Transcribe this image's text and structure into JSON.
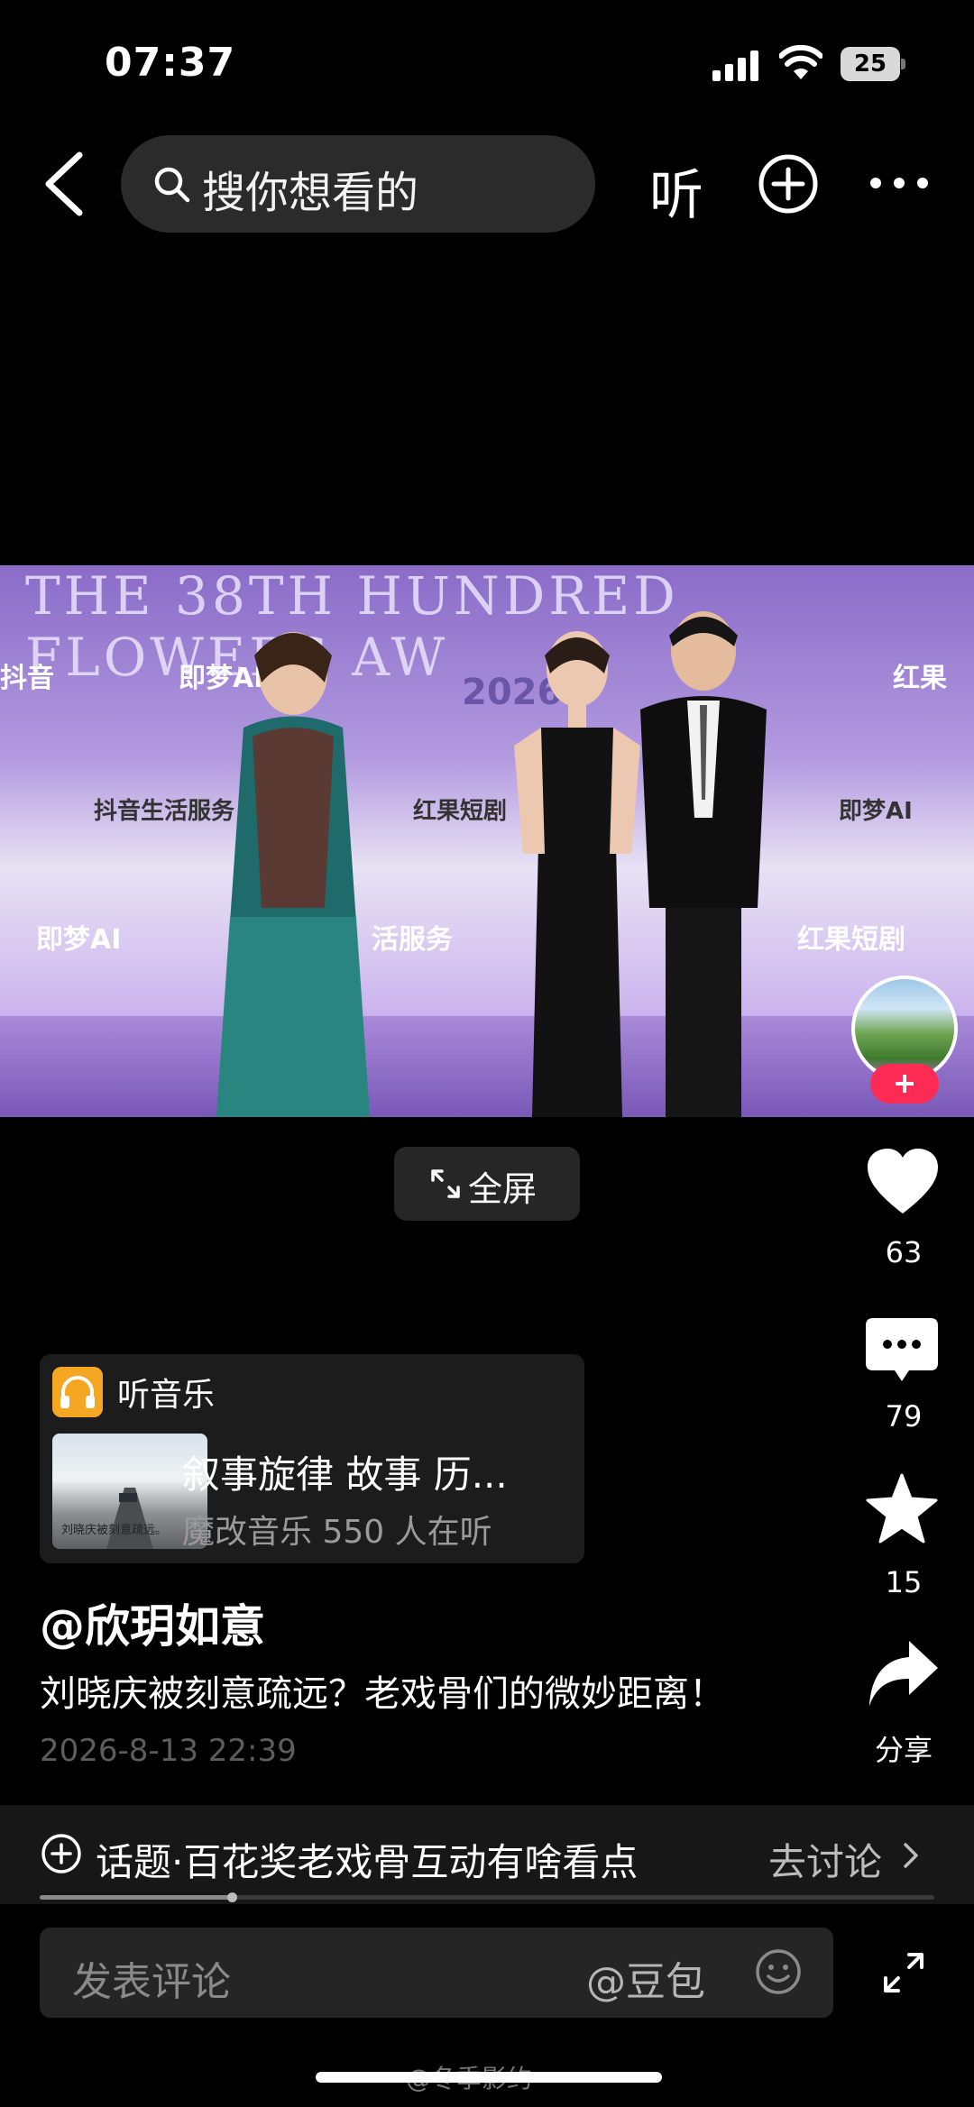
{
  "status_bar": {
    "time": "07:37",
    "battery": "25"
  },
  "nav": {
    "search_placeholder": "搜你想看的",
    "listen_label": "听"
  },
  "video": {
    "banner_text": "THE 38TH HUNDRED FLOWERS AW",
    "year_text": "2026",
    "sponsor_logos": [
      "抖音",
      "即梦AI",
      "红果",
      "抖音生活服务",
      "红果短剧",
      "即梦AI",
      "即梦AI",
      "活服务",
      "红果短剧"
    ]
  },
  "fullscreen": {
    "label": "全屏"
  },
  "rail": {
    "likes": "63",
    "comments": "79",
    "favorites": "15",
    "share_label": "分享"
  },
  "music": {
    "header": "听音乐",
    "title": "叙事旋律 故事 历...",
    "subtitle": "魔改音乐 550 人在听",
    "cover_text": "刘晓庆被刻意疏远。"
  },
  "post": {
    "author": "@欣玥如意",
    "caption": "刘晓庆被刻意疏远？老戏骨们的微妙距离！",
    "timestamp": "2026-8-13 22:39"
  },
  "topic": {
    "text": "话题·百花奖老戏骨互动有啥看点",
    "action": "去讨论"
  },
  "playback": {
    "progress": 0.215
  },
  "comment": {
    "placeholder": "发表评论",
    "mention": "@豆包"
  },
  "watermark": "@冬季影约",
  "colors": {
    "accent_red": "#fe2c55",
    "music_icon": "#f5a623",
    "background": "#000000"
  }
}
